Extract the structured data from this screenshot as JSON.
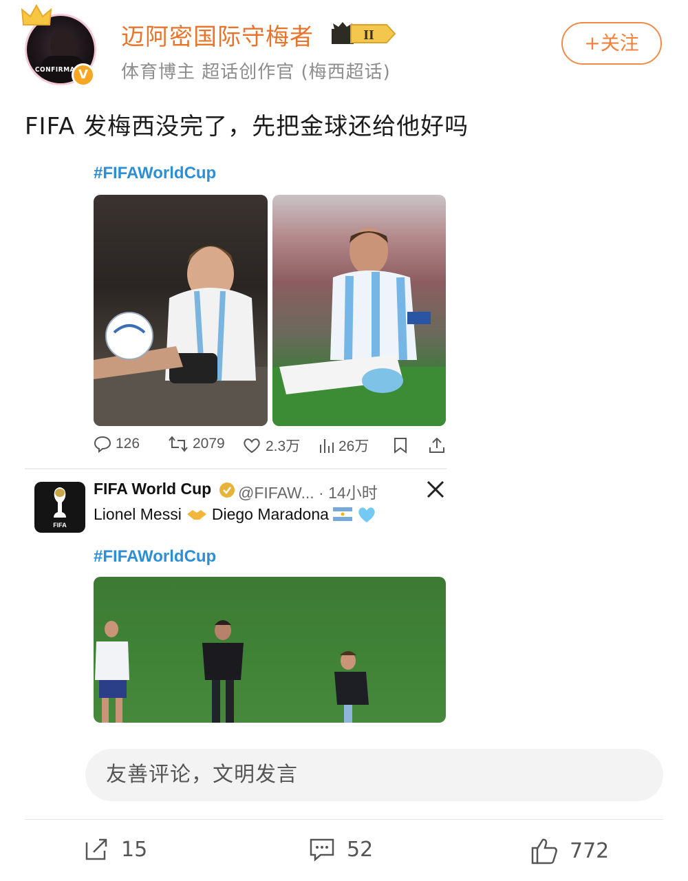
{
  "header": {
    "username": "迈阿密国际守梅者",
    "vip_level": "II",
    "subtitle": "体育博主 超话创作官 (梅西超话)",
    "avatar_text": "CONFIRMADO",
    "follow_label": "+关注"
  },
  "post": {
    "text": "FIFA 发梅西没完了，先把金球还给他好吗"
  },
  "embed_top": {
    "hashtag": "#FIFAWorldCup",
    "stats": {
      "replies": "126",
      "retweets": "2079",
      "likes": "2.3万",
      "views": "26万"
    }
  },
  "embed_tweet": {
    "name": "FIFA World Cup",
    "handle": "@FIFAW... · 14小时",
    "body_left": "Lionel Messi",
    "body_right": "Diego Maradona",
    "hashtag": "#FIFAWorldCup",
    "logo_text": "FIFA"
  },
  "comment": {
    "placeholder": "友善评论，文明发言"
  },
  "actions": {
    "reposts": "15",
    "comments": "52",
    "likes": "772"
  },
  "colors": {
    "brand_orange": "#e8742b",
    "hashtag_blue": "#2c8fd6"
  }
}
